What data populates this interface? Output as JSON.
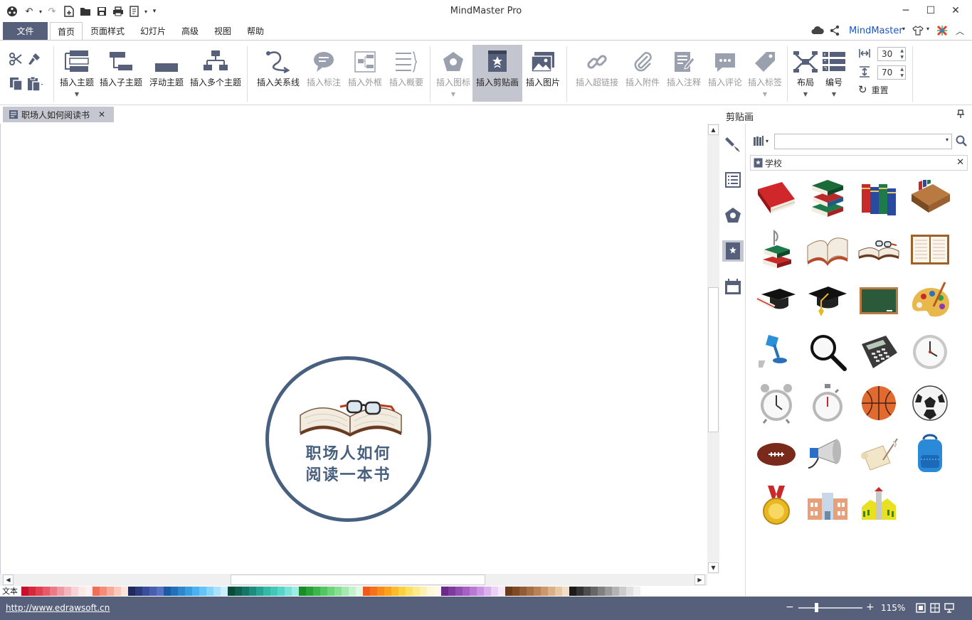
{
  "app": {
    "title": "MindMaster Pro"
  },
  "menu": {
    "file": "文件",
    "tabs": [
      "首页",
      "页面样式",
      "幻灯片",
      "高级",
      "视图",
      "帮助"
    ],
    "brand": "MindMaster"
  },
  "ribbon": {
    "insert_topic": "插入主题",
    "insert_subtopic": "插入子主题",
    "floating_topic": "浮动主题",
    "insert_multiple": "插入多个主题",
    "insert_relation": "插入关系线",
    "insert_callout": "插入标注",
    "insert_boundary": "插入外框",
    "insert_summary": "插入概要",
    "insert_icon": "插入图标",
    "insert_clipart": "插入剪贴画",
    "insert_picture": "插入图片",
    "insert_hyperlink": "插入超链接",
    "insert_attachment": "插入附件",
    "insert_note": "插入注释",
    "insert_comment": "插入评论",
    "insert_tag": "插入标签",
    "layout": "布局",
    "numbering": "编号",
    "spacing_h": "30",
    "spacing_v": "70",
    "reset": "重置"
  },
  "document": {
    "tab_name": "职场人如何阅读书",
    "central_topic_line1": "职场人如何",
    "central_topic_line2": "阅读一本书"
  },
  "colorstrip": {
    "label": "文本",
    "colors": [
      "#c8102e",
      "#d6283a",
      "#e04050",
      "#e85a6a",
      "#ec7a86",
      "#f098a2",
      "#f4b6bd",
      "#f8d2d6",
      "#fbe6e8",
      "#fff0f2",
      "#f06e5a",
      "#f48c78",
      "#f8aa98",
      "#fbc8ba",
      "#fde3da",
      "#1f2a5a",
      "#2a3a7a",
      "#3a4c9a",
      "#4a5eb0",
      "#5a70c4",
      "#1a5aa0",
      "#2470b8",
      "#2e86cc",
      "#3a9ce0",
      "#4ab2f0",
      "#62c4f8",
      "#84d4fc",
      "#a8e2fe",
      "#cceefe",
      "#0a4a3a",
      "#106050",
      "#167666",
      "#1e8c7c",
      "#28a292",
      "#34b8a8",
      "#42c8b8",
      "#56d6c8",
      "#7ae2d6",
      "#9ceee4",
      "#1a8a2a",
      "#2aa03a",
      "#3cb64c",
      "#52c660",
      "#6ad478",
      "#86e092",
      "#a4eaae",
      "#c4f2ca",
      "#e2f8e4",
      "#f05a1a",
      "#f4721a",
      "#f88a1a",
      "#fba21a",
      "#fdba2a",
      "#fdd040",
      "#fde060",
      "#feea88",
      "#fef2b0",
      "#fef8d8",
      "#fffbe8",
      "#6a2a8a",
      "#7e3a9e",
      "#924cb2",
      "#a660c4",
      "#b878d4",
      "#ca92e2",
      "#dcb0ee",
      "#ecd0f6",
      "#f6e8fb",
      "#6a3a1a",
      "#7e4a26",
      "#925c34",
      "#a66e44",
      "#b88256",
      "#ca986c",
      "#dab086",
      "#e8c8a4",
      "#f2dec4",
      "#1a1a1a",
      "#333333",
      "#4d4d4d",
      "#666666",
      "#808080",
      "#999999",
      "#b3b3b3",
      "#cccccc",
      "#e0e0e0",
      "#f0f0f0",
      "#ffffff"
    ]
  },
  "panel": {
    "title": "剪贴画",
    "search_placeholder": "",
    "category": "学校"
  },
  "statusbar": {
    "link": "http://www.edrawsoft.cn",
    "zoom": "115%"
  }
}
